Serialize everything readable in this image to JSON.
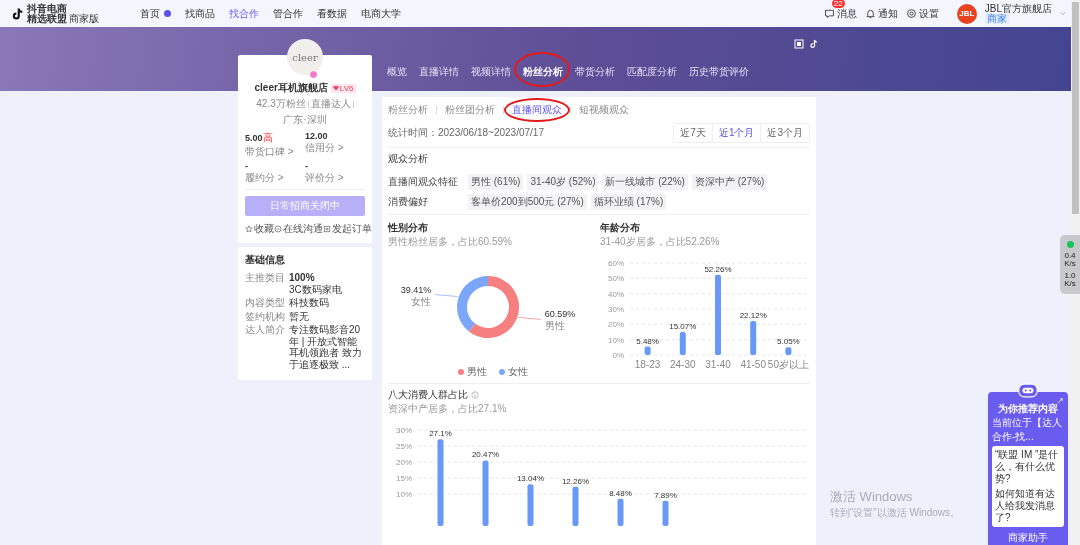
{
  "top_nav": {
    "logo_small": "抖音电商",
    "logo_main": "精选联盟",
    "logo_edition": "商家版",
    "items": [
      {
        "label": "首页",
        "selected": false,
        "dot": true
      },
      {
        "label": "找商品",
        "selected": false,
        "dot": false
      },
      {
        "label": "找合作",
        "selected": true,
        "dot": false
      },
      {
        "label": "管合作",
        "selected": false,
        "dot": false
      },
      {
        "label": "看数据",
        "selected": false,
        "dot": false
      },
      {
        "label": "电商大学",
        "selected": false,
        "dot": false
      }
    ],
    "messages": {
      "label": "消息",
      "badge": "22"
    },
    "notice": "通知",
    "settings": "设置",
    "account": {
      "avatar_text": "JBL",
      "name": "JBL官方旗舰店",
      "tag": "商家"
    }
  },
  "profile": {
    "avatar_text": "cleer",
    "name": "cleer耳机旗舰店",
    "level": "LV6",
    "meta": [
      "42.3万粉丝",
      "直播达人",
      "广东·深圳"
    ],
    "scores": [
      {
        "value": "5.00",
        "flag": "高",
        "label": "带货口碑 >"
      },
      {
        "value": "12.00",
        "label": "信用分 >"
      },
      {
        "value": "-",
        "label": "履约分 >"
      },
      {
        "value": "-",
        "label": "评价分 >"
      }
    ],
    "invite_button": {
      "label": "日常招商关闭中",
      "disabled": true
    },
    "actions": [
      {
        "kind": "star",
        "label": "收藏"
      },
      {
        "kind": "chat",
        "label": "在线沟通"
      },
      {
        "kind": "order",
        "label": "发起订单"
      }
    ]
  },
  "basic_info": {
    "title": "基础信息",
    "rows": [
      {
        "label": "主推类目",
        "value": "100%",
        "sub": "3C数码家电"
      },
      {
        "label": "内容类型",
        "value": "科技数码"
      },
      {
        "label": "签约机构",
        "value": "暂无"
      },
      {
        "label": "达人简介",
        "value": "专注数码影音20年 | 开放式智能耳机领跑者 致力于追逐极致 ..."
      }
    ]
  },
  "tabs": [
    {
      "label": "概览",
      "selected": false,
      "circled": false
    },
    {
      "label": "直播详情",
      "selected": false,
      "circled": false
    },
    {
      "label": "视频详情",
      "selected": false,
      "circled": false
    },
    {
      "label": "粉丝分析",
      "selected": true,
      "circled": true
    },
    {
      "label": "带货分析",
      "selected": false,
      "circled": false
    },
    {
      "label": "匹配度分析",
      "selected": false,
      "circled": false
    },
    {
      "label": "历史带货评价",
      "selected": false,
      "circled": false
    }
  ],
  "sub_tabs": [
    {
      "label": "粉丝分析",
      "selected": false,
      "circled": false
    },
    {
      "label": "粉丝团分析",
      "selected": false,
      "circled": false
    },
    {
      "label": "直播间观众",
      "selected": true,
      "circled": true
    },
    {
      "label": "短视频观众",
      "selected": false,
      "circled": false
    }
  ],
  "stats_period": "统计时间：2023/06/18~2023/07/17",
  "range_buttons": [
    {
      "label": "近7天",
      "selected": false
    },
    {
      "label": "近1个月",
      "selected": true
    },
    {
      "label": "近3个月",
      "selected": false
    }
  ],
  "audience": {
    "title": "观众分析",
    "rows": [
      {
        "label": "直播间观众特征",
        "tags": [
          "男性 (61%)",
          "31-40岁 (52%)",
          "新一线城市 (22%)",
          "资深中产 (27%)"
        ]
      },
      {
        "label": "消费偏好",
        "tags": [
          "客单价200到500元 (27%)",
          "循环业绩 (17%)"
        ]
      }
    ]
  },
  "gender": {
    "title": "性别分布",
    "subtitle": "男性粉丝居多，占比60.59%",
    "chart_data": {
      "type": "donut",
      "categories": [
        "男性",
        "女性"
      ],
      "values": [
        60.59,
        39.41
      ],
      "colors": [
        "#f67f7f",
        "#7ca6fa"
      ],
      "value_labels": [
        "60.59%",
        "39.41%"
      ]
    }
  },
  "age": {
    "title": "年龄分布",
    "subtitle": "31-40岁居多，占比52.26%",
    "chart_data": {
      "type": "bar",
      "categories": [
        "18-23",
        "24-30",
        "31-40",
        "41-50",
        "50岁以上"
      ],
      "series": [
        {
          "color": "#6a98f6",
          "values": [
            5.48,
            15.07,
            52.26,
            22.12,
            5.05
          ]
        }
      ],
      "value_labels": [
        "5.48%",
        "15.07%",
        "52.26%",
        "22.12%",
        "5.05%"
      ],
      "ylim": [
        0,
        60
      ],
      "grid": true,
      "yticks": [
        {
          "value": 0,
          "label": "0%"
        },
        {
          "value": 10,
          "label": "10%"
        },
        {
          "value": 20,
          "label": "20%"
        },
        {
          "value": 30,
          "label": "30%"
        },
        {
          "value": 40,
          "label": "40%"
        },
        {
          "value": 50,
          "label": "50%"
        },
        {
          "value": 60,
          "label": "60%"
        }
      ]
    }
  },
  "consumers": {
    "title": "八大消费人群占比",
    "subtitle": "资深中产居多，占比27.1%",
    "chart_data": {
      "type": "bar",
      "series": [
        {
          "color": "#6a98f6",
          "values": [
            27.1,
            20.47,
            13.04,
            12.26,
            8.48,
            7.89
          ]
        }
      ],
      "value_labels": [
        "27.1%",
        "20.47%",
        "13.04%",
        "12.26%",
        "8.48%",
        "7.89%"
      ],
      "ylim": [
        0,
        30
      ],
      "grid": true,
      "yticks": [
        {
          "value": 10,
          "label": "10%"
        },
        {
          "value": 15,
          "label": "15%"
        },
        {
          "value": 20,
          "label": "20%"
        },
        {
          "value": 25,
          "label": "25%"
        },
        {
          "value": 30,
          "label": "30%"
        }
      ]
    }
  },
  "net_speed": [
    "0.4 K/s",
    "1.0 K/s"
  ],
  "assistant": {
    "title": "为你推荐内容",
    "location": "当前位于【达人合作-找...",
    "questions": [
      "“联盟 IM ”是什么，有什么优势?",
      "如何知道有达人给我发消息了?"
    ],
    "button": "商家助手"
  },
  "os_notice": {
    "title": "激活 Windows",
    "text": "转到“设置”以激活 Windows。"
  }
}
